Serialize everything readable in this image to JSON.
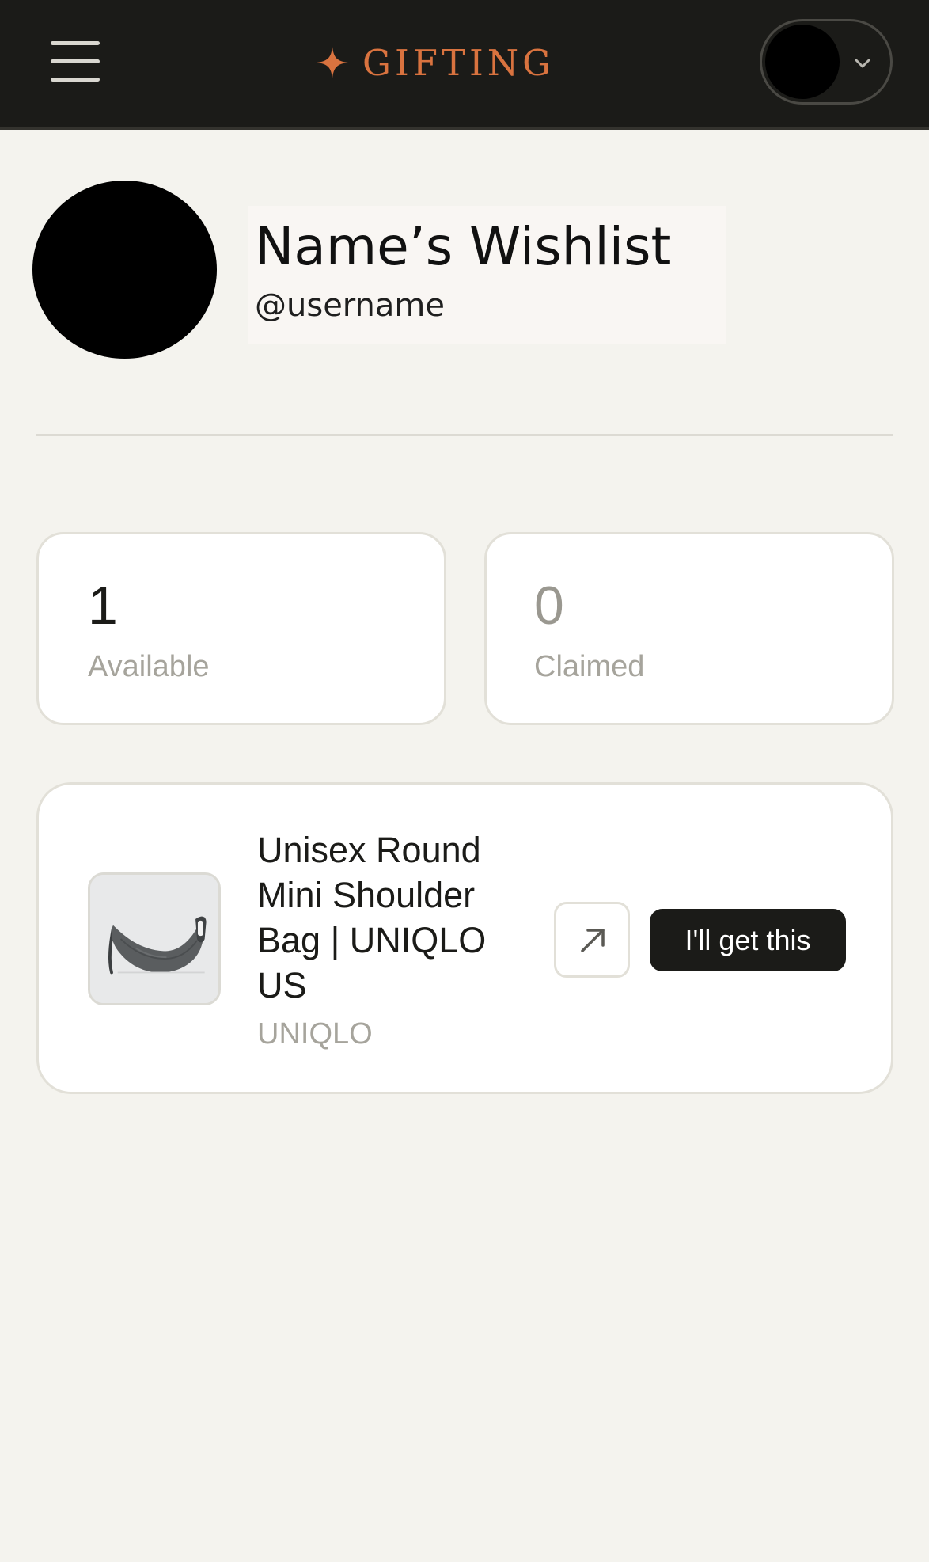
{
  "header": {
    "brand_name": "GIFTING",
    "brand_icon": "sparkle-star-icon",
    "menu_icon": "hamburger-menu-icon",
    "account_chevron_icon": "chevron-down-icon",
    "brand_color": "#d9733f",
    "background_color": "#1b1b18"
  },
  "profile": {
    "title": "Name’s Wishlist",
    "username": "@username"
  },
  "stats": {
    "available": {
      "value": "1",
      "label": "Available"
    },
    "claimed": {
      "value": "0",
      "label": "Claimed"
    }
  },
  "items": [
    {
      "title": "Unisex Round Mini Shoulder Bag | UNIQLO US",
      "store": "UNIQLO",
      "open_link_icon": "arrow-up-right-icon",
      "claim_label": "I'll get this"
    }
  ]
}
